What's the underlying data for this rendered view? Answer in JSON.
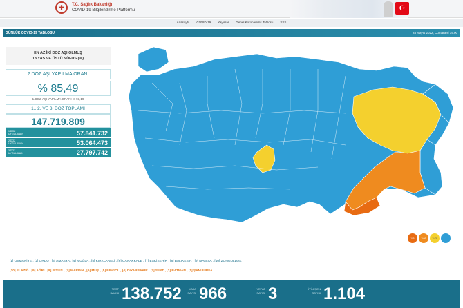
{
  "header": {
    "org": "T.C. Sağlık Bakanlığı",
    "platform": "COVID-19 Bilgilendirme Platformu"
  },
  "nav": [
    "Anasayfa",
    "COVID-19",
    "Yayınlar",
    "Genel Koronavirüs Tablosu",
    "SSS"
  ],
  "title_bar": {
    "title": "GÜNLÜK COVID-19 TABLOSU",
    "date": "28 Mayıs 2022, Cumartesi 19:00"
  },
  "vaccine_panel": {
    "header_line1": "EN AZ İKİ DOZ AŞI OLMUŞ",
    "header_line2": "18 YAŞ VE ÜSTÜ NÜFUS (%)",
    "two_dose_label": "2 DOZ AŞI YAPILMA ORANI",
    "two_dose_value": "% 85,49",
    "one_dose_line": "1.DOZ AŞI YAPILMA ORANI  % 93,19",
    "total_label": "1., 2. VE 3. DOZ TOPLAMI",
    "total_value": "147.719.809",
    "doses": [
      {
        "label": "1.DOZ UYGULANAN",
        "value": "57.841.732"
      },
      {
        "label": "2.DOZ UYGULANAN",
        "value": "53.064.473"
      },
      {
        "label": "3.DOZ UYGULANAN",
        "value": "27.797.742"
      }
    ]
  },
  "map": {
    "colors": {
      "blue": "#2f9ed6",
      "yellow": "#f4d02e",
      "orange": "#ef8b1f",
      "dark_orange": "#e86b12"
    },
    "legend": [
      "%0",
      "%50",
      "%75",
      ""
    ]
  },
  "lists": {
    "top": "[1] OSMANİYE , [2] ORDU , [3] AMASYA , [4] MUĞLA , [5] KIRKLARELİ , [6] ÇANAKKALE , [7] ESKİŞEHİR , [8] BALIKESİR , [9] MANİSA , [10] ZONGULDAK",
    "bottom_part1": "[10] ELAZIĞ , [9] AĞRI , [8] BİTLİS , [7] MARDİN , [6] MUŞ , ",
    "bottom_part2": "[5] BİNGÖL , [4] DİYARBAKIR , [3] SİİRT , [2] BATMAN , [1] ŞANLIURFA"
  },
  "stats": [
    {
      "label1": "TEST",
      "label2": "SAYISI",
      "value": "138.752"
    },
    {
      "label1": "VAKA",
      "label2": "SAYISI",
      "value": "966"
    },
    {
      "label1": "VEFAT",
      "label2": "SAYISI",
      "value": "3"
    },
    {
      "label1": "İYİLEŞEN",
      "label2": "SAYISI",
      "value": "1.104"
    }
  ]
}
